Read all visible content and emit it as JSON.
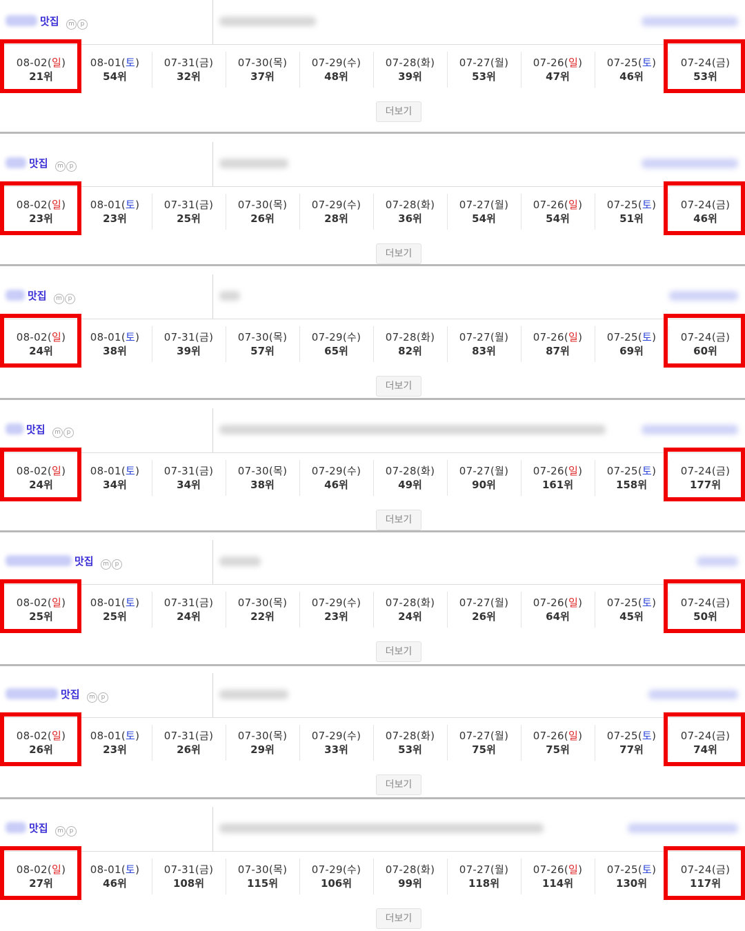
{
  "more_label": "더보기",
  "accent_red": "#f00000",
  "sunday_color": "#e02424",
  "saturday_color": "#2b45d8",
  "blocks": [
    {
      "keyword_suffix": "맛집",
      "badges": [
        "m",
        "p"
      ],
      "dates": [
        {
          "md": "08-02",
          "day": "일",
          "kind": "sun",
          "rank": "21위"
        },
        {
          "md": "08-01",
          "day": "토",
          "kind": "sat",
          "rank": "54위"
        },
        {
          "md": "07-31",
          "day": "금",
          "kind": "",
          "rank": "32위"
        },
        {
          "md": "07-30",
          "day": "목",
          "kind": "",
          "rank": "37위"
        },
        {
          "md": "07-29",
          "day": "수",
          "kind": "",
          "rank": "48위"
        },
        {
          "md": "07-28",
          "day": "화",
          "kind": "",
          "rank": "39위"
        },
        {
          "md": "07-27",
          "day": "월",
          "kind": "",
          "rank": "53위"
        },
        {
          "md": "07-26",
          "day": "일",
          "kind": "sun",
          "rank": "47위"
        },
        {
          "md": "07-25",
          "day": "토",
          "kind": "sat",
          "rank": "46위"
        },
        {
          "md": "07-24",
          "day": "금",
          "kind": "",
          "rank": "53위"
        }
      ]
    },
    {
      "keyword_suffix": "맛집",
      "badges": [
        "m",
        "p"
      ],
      "dates": [
        {
          "md": "08-02",
          "day": "일",
          "kind": "sun",
          "rank": "23위"
        },
        {
          "md": "08-01",
          "day": "토",
          "kind": "sat",
          "rank": "23위"
        },
        {
          "md": "07-31",
          "day": "금",
          "kind": "",
          "rank": "25위"
        },
        {
          "md": "07-30",
          "day": "목",
          "kind": "",
          "rank": "26위"
        },
        {
          "md": "07-29",
          "day": "수",
          "kind": "",
          "rank": "28위"
        },
        {
          "md": "07-28",
          "day": "화",
          "kind": "",
          "rank": "36위"
        },
        {
          "md": "07-27",
          "day": "월",
          "kind": "",
          "rank": "54위"
        },
        {
          "md": "07-26",
          "day": "일",
          "kind": "sun",
          "rank": "54위"
        },
        {
          "md": "07-25",
          "day": "토",
          "kind": "sat",
          "rank": "51위"
        },
        {
          "md": "07-24",
          "day": "금",
          "kind": "",
          "rank": "46위"
        }
      ]
    },
    {
      "keyword_suffix": "맛집",
      "badges": [
        "m",
        "p"
      ],
      "dates": [
        {
          "md": "08-02",
          "day": "일",
          "kind": "sun",
          "rank": "24위"
        },
        {
          "md": "08-01",
          "day": "토",
          "kind": "sat",
          "rank": "38위"
        },
        {
          "md": "07-31",
          "day": "금",
          "kind": "",
          "rank": "39위"
        },
        {
          "md": "07-30",
          "day": "목",
          "kind": "",
          "rank": "57위"
        },
        {
          "md": "07-29",
          "day": "수",
          "kind": "",
          "rank": "65위"
        },
        {
          "md": "07-28",
          "day": "화",
          "kind": "",
          "rank": "82위"
        },
        {
          "md": "07-27",
          "day": "월",
          "kind": "",
          "rank": "83위"
        },
        {
          "md": "07-26",
          "day": "일",
          "kind": "sun",
          "rank": "87위"
        },
        {
          "md": "07-25",
          "day": "토",
          "kind": "sat",
          "rank": "69위"
        },
        {
          "md": "07-24",
          "day": "금",
          "kind": "",
          "rank": "60위"
        }
      ]
    },
    {
      "keyword_suffix": "맛집",
      "badges": [
        "m",
        "p"
      ],
      "dates": [
        {
          "md": "08-02",
          "day": "일",
          "kind": "sun",
          "rank": "24위"
        },
        {
          "md": "08-01",
          "day": "토",
          "kind": "sat",
          "rank": "34위"
        },
        {
          "md": "07-31",
          "day": "금",
          "kind": "",
          "rank": "34위"
        },
        {
          "md": "07-30",
          "day": "목",
          "kind": "",
          "rank": "38위"
        },
        {
          "md": "07-29",
          "day": "수",
          "kind": "",
          "rank": "46위"
        },
        {
          "md": "07-28",
          "day": "화",
          "kind": "",
          "rank": "49위"
        },
        {
          "md": "07-27",
          "day": "월",
          "kind": "",
          "rank": "90위"
        },
        {
          "md": "07-26",
          "day": "일",
          "kind": "sun",
          "rank": "161위"
        },
        {
          "md": "07-25",
          "day": "토",
          "kind": "sat",
          "rank": "158위"
        },
        {
          "md": "07-24",
          "day": "금",
          "kind": "",
          "rank": "177위"
        }
      ]
    },
    {
      "keyword_suffix": "맛집",
      "badges": [
        "m",
        "p"
      ],
      "dates": [
        {
          "md": "08-02",
          "day": "일",
          "kind": "sun",
          "rank": "25위"
        },
        {
          "md": "08-01",
          "day": "토",
          "kind": "sat",
          "rank": "25위"
        },
        {
          "md": "07-31",
          "day": "금",
          "kind": "",
          "rank": "24위"
        },
        {
          "md": "07-30",
          "day": "목",
          "kind": "",
          "rank": "22위"
        },
        {
          "md": "07-29",
          "day": "수",
          "kind": "",
          "rank": "23위"
        },
        {
          "md": "07-28",
          "day": "화",
          "kind": "",
          "rank": "24위"
        },
        {
          "md": "07-27",
          "day": "월",
          "kind": "",
          "rank": "26위"
        },
        {
          "md": "07-26",
          "day": "일",
          "kind": "sun",
          "rank": "64위"
        },
        {
          "md": "07-25",
          "day": "토",
          "kind": "sat",
          "rank": "45위"
        },
        {
          "md": "07-24",
          "day": "금",
          "kind": "",
          "rank": "50위"
        }
      ]
    },
    {
      "keyword_suffix": "맛집",
      "badges": [
        "m",
        "p"
      ],
      "dates": [
        {
          "md": "08-02",
          "day": "일",
          "kind": "sun",
          "rank": "26위"
        },
        {
          "md": "08-01",
          "day": "토",
          "kind": "sat",
          "rank": "23위"
        },
        {
          "md": "07-31",
          "day": "금",
          "kind": "",
          "rank": "26위"
        },
        {
          "md": "07-30",
          "day": "목",
          "kind": "",
          "rank": "29위"
        },
        {
          "md": "07-29",
          "day": "수",
          "kind": "",
          "rank": "33위"
        },
        {
          "md": "07-28",
          "day": "화",
          "kind": "",
          "rank": "53위"
        },
        {
          "md": "07-27",
          "day": "월",
          "kind": "",
          "rank": "75위"
        },
        {
          "md": "07-26",
          "day": "일",
          "kind": "sun",
          "rank": "75위"
        },
        {
          "md": "07-25",
          "day": "토",
          "kind": "sat",
          "rank": "77위"
        },
        {
          "md": "07-24",
          "day": "금",
          "kind": "",
          "rank": "74위"
        }
      ]
    },
    {
      "keyword_suffix": "맛집",
      "badges": [
        "m",
        "p"
      ],
      "dates": [
        {
          "md": "08-02",
          "day": "일",
          "kind": "sun",
          "rank": "27위"
        },
        {
          "md": "08-01",
          "day": "토",
          "kind": "sat",
          "rank": "46위"
        },
        {
          "md": "07-31",
          "day": "금",
          "kind": "",
          "rank": "108위"
        },
        {
          "md": "07-30",
          "day": "목",
          "kind": "",
          "rank": "115위"
        },
        {
          "md": "07-29",
          "day": "수",
          "kind": "",
          "rank": "106위"
        },
        {
          "md": "07-28",
          "day": "화",
          "kind": "",
          "rank": "99위"
        },
        {
          "md": "07-27",
          "day": "월",
          "kind": "",
          "rank": "118위"
        },
        {
          "md": "07-26",
          "day": "일",
          "kind": "sun",
          "rank": "114위"
        },
        {
          "md": "07-25",
          "day": "토",
          "kind": "sat",
          "rank": "130위"
        },
        {
          "md": "07-24",
          "day": "금",
          "kind": "",
          "rank": "117위"
        }
      ]
    }
  ]
}
